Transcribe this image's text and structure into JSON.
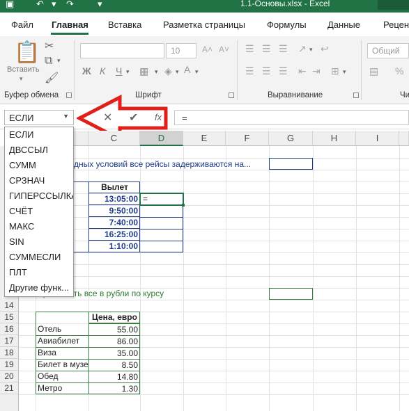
{
  "title_bar": {
    "file_title": "1.1-Основы.xlsx  -  Excel"
  },
  "tabs": [
    "Файл",
    "Главная",
    "Вставка",
    "Разметка страницы",
    "Формулы",
    "Данные",
    "Рецен"
  ],
  "ribbon": {
    "paste_label": "Вставить",
    "font_combo": "",
    "size_combo": "10",
    "number_format": "Общий",
    "bold": "Ж",
    "italic": "К",
    "underline": "Ч",
    "groups": {
      "clipboard": "Буфер обмена",
      "font": "Шрифт",
      "alignment": "Выравнивание",
      "extra": "Чи"
    }
  },
  "formula_bar": {
    "name_box": "ЕСЛИ",
    "formula": "=",
    "fx": "fx"
  },
  "function_dropdown": [
    "ЕСЛИ",
    "ДВССЫЛ",
    "СУММ",
    "СРЗНАЧ",
    "ГИПЕРССЫЛКА",
    "СЧЁТ",
    "МАКС",
    "SIN",
    "СУММЕСЛИ",
    "ПЛТ",
    "Другие функ..."
  ],
  "columns": [
    "C",
    "D",
    "E",
    "F",
    "G",
    "H",
    "I"
  ],
  "rows": [
    "14",
    "15",
    "16",
    "17",
    "18",
    "19",
    "20",
    "21"
  ],
  "sheet": {
    "r2_text": "дных условий все рейсы задерживаются на...",
    "departure_header": "Вылет",
    "departures": [
      "13:05:00",
      "9:50:00",
      "7:40:00",
      "16:25:00",
      "1:10:00"
    ],
    "active_cell": "=",
    "r13_text": "ересчитать все в рубли по курсу",
    "price_header": "Цена, евро",
    "items": [
      {
        "name": "Отель",
        "price": "55.00"
      },
      {
        "name": "Авиабилет",
        "price": "86.00"
      },
      {
        "name": "Виза",
        "price": "35.00"
      },
      {
        "name": "Билет в музей",
        "price": "8.50"
      },
      {
        "name": "Обед",
        "price": "14.80"
      },
      {
        "name": "Метро",
        "price": "1.30"
      }
    ]
  },
  "colors": {
    "excel_green": "#217346",
    "arrow_red": "#e0201b",
    "time_blue": "#1f3c88"
  }
}
